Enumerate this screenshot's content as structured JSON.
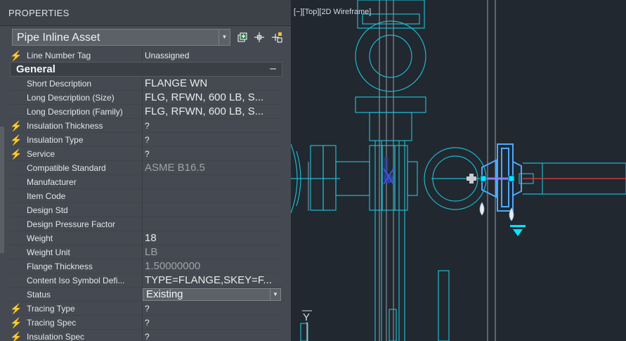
{
  "palette": {
    "title": "PROPERTIES",
    "selector_value": "Pipe Inline Asset",
    "tool_icons": [
      "quick-select-icon",
      "pick-object-icon",
      "toggle-pickadd-icon"
    ],
    "line_number": {
      "label": "Line Number Tag",
      "value": "Unassigned"
    },
    "section_title": "General",
    "section_toggle": "–",
    "rows": [
      {
        "label": "Short Description",
        "value": "FLANGE WN",
        "style": "big"
      },
      {
        "label": "Long Description (Size)",
        "value": "FLG, RFWN, 600 LB, S...",
        "style": "big"
      },
      {
        "label": "Long Description (Family)",
        "value": "FLG, RFWN, 600 LB, S...",
        "style": "big"
      },
      {
        "label": "Insulation Thickness",
        "value": "?",
        "bolt": true
      },
      {
        "label": "Insulation Type",
        "value": "?",
        "bolt": true
      },
      {
        "label": "Service",
        "value": "?",
        "bolt": true
      },
      {
        "label": "Compatible Standard",
        "value": "ASME B16.5",
        "style": "big gray"
      },
      {
        "label": "Manufacturer",
        "value": ""
      },
      {
        "label": "Item Code",
        "value": ""
      },
      {
        "label": "Design Std",
        "value": ""
      },
      {
        "label": "Design Pressure Factor",
        "value": ""
      },
      {
        "label": "Weight",
        "value": "18",
        "style": "big"
      },
      {
        "label": "Weight Unit",
        "value": "LB",
        "style": "big gray"
      },
      {
        "label": "Flange Thickness",
        "value": "1.50000000",
        "style": "big gray"
      },
      {
        "label": "Content Iso Symbol Defi...",
        "value": "TYPE=FLANGE,SKEY=F...",
        "style": "big"
      },
      {
        "label": "Status",
        "value": "Existing",
        "dropdown": true
      },
      {
        "label": "Tracing Type",
        "value": "?",
        "bolt": true
      },
      {
        "label": "Tracing Spec",
        "value": "?",
        "bolt": true
      },
      {
        "label": "Insulation Spec",
        "value": "?",
        "bolt": true
      }
    ]
  },
  "viewport": {
    "label": "[−][Top][2D Wireframe]",
    "ucs_label": "Y"
  },
  "colors": {
    "cyan": "#1fb8cc",
    "grip": "#00e5ff",
    "selected": "#4da9ff",
    "red_line": "#c23b3b",
    "bolt": "#f3c12e"
  }
}
